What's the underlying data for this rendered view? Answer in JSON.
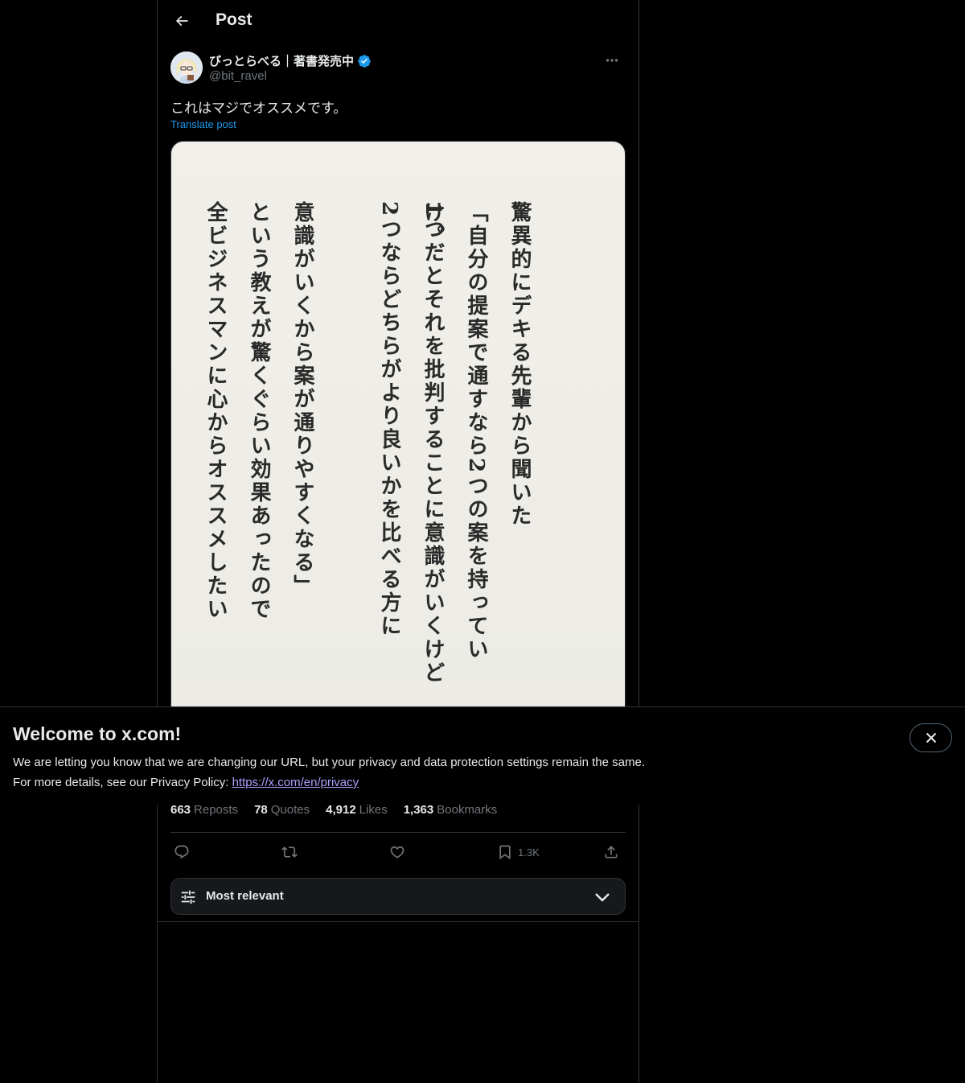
{
  "header": {
    "title": "Post"
  },
  "post": {
    "display_name": "びっとらべる｜著書発売中",
    "handle": "@bit_ravel",
    "text": "これはマジでオススメです。",
    "translate_label": "Translate post",
    "image_lines": [
      "驚異的にデキる先輩から聞いた",
      "「自分の提案で通すなら2つの案を持っていけ。",
      "1つだとそれを批判することに意識がいくけど",
      "2つならどちらがより良いかを比べる方に",
      "意識がいくから案が通りやすくなる」",
      "という教えが驚くぐらい効果あったので",
      "全ビジネスマンに心からオススメしたい"
    ]
  },
  "stats": {
    "reposts_value": "663",
    "reposts_label": "Reposts",
    "quotes_value": "78",
    "quotes_label": "Quotes",
    "likes_value": "4,912",
    "likes_label": "Likes",
    "bookmarks_value": "1,363",
    "bookmarks_label": "Bookmarks"
  },
  "actions": {
    "bookmark_count": "1.3K"
  },
  "replies_sort": {
    "label": "Most relevant"
  },
  "banner": {
    "title": "Welcome to x.com!",
    "line1": "We are letting you know that we are changing our URL, but your privacy and data protection settings remain the same.",
    "line2_prefix": "For more details, see our Privacy Policy: ",
    "link": "https://x.com/en/privacy"
  },
  "colors": {
    "accent": "#1d9bf0",
    "background": "#000000",
    "muted": "#71767b",
    "link_purple": "#a9a0ff"
  },
  "icons": [
    "back-arrow-icon",
    "verified-badge-icon",
    "more-icon",
    "reply-icon",
    "repost-icon",
    "like-icon",
    "bookmark-icon",
    "share-icon",
    "sliders-icon",
    "chevron-down-icon",
    "close-icon"
  ]
}
